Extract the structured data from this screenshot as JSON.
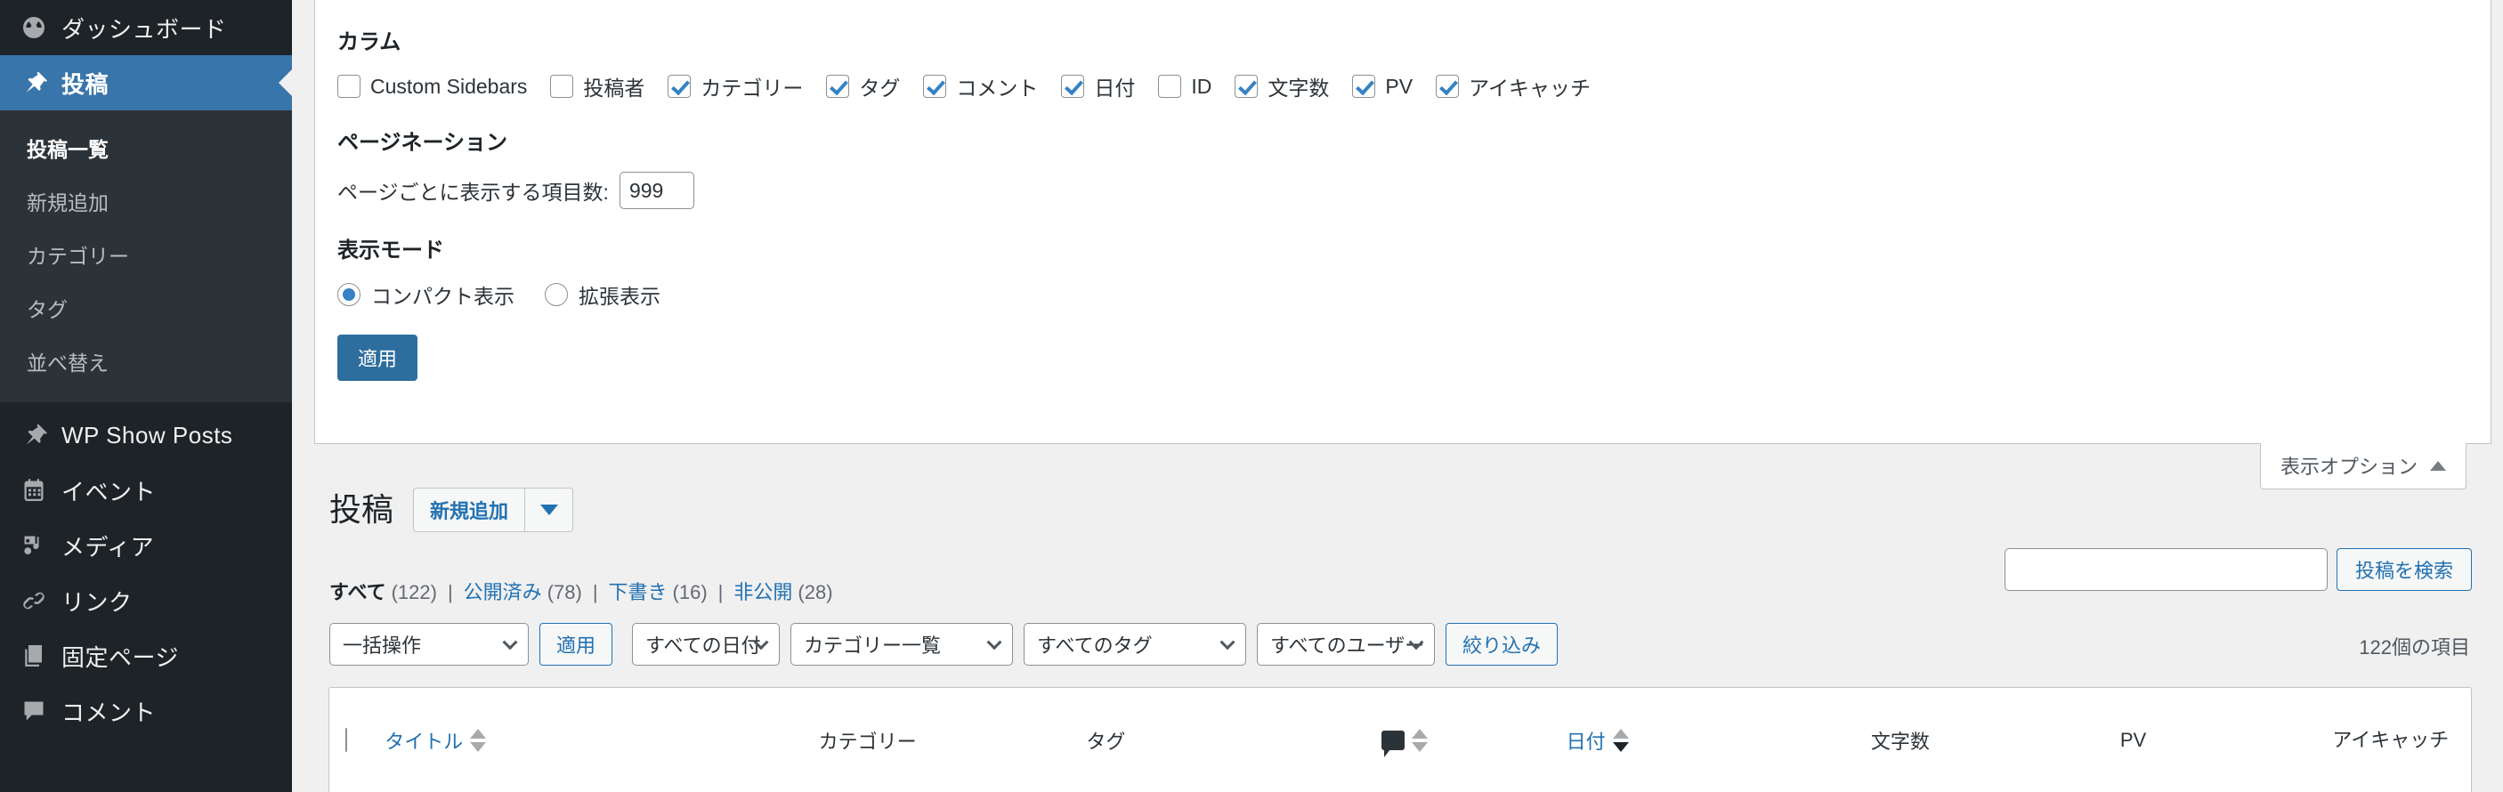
{
  "sidebar": {
    "items": [
      {
        "label": "ダッシュボード",
        "icon": "dashboard-icon",
        "current": false
      },
      {
        "label": "投稿",
        "icon": "pin-icon",
        "current": true
      }
    ],
    "submenu": [
      {
        "label": "投稿一覧",
        "current": true
      },
      {
        "label": "新規追加",
        "current": false
      },
      {
        "label": "カテゴリー",
        "current": false
      },
      {
        "label": "タグ",
        "current": false
      },
      {
        "label": "並べ替え",
        "current": false
      }
    ],
    "items2": [
      {
        "label": "WP Show Posts",
        "icon": "pin-icon"
      },
      {
        "label": "イベント",
        "icon": "calendar-icon"
      },
      {
        "label": "メディア",
        "icon": "media-icon"
      },
      {
        "label": "リンク",
        "icon": "link-icon"
      },
      {
        "label": "固定ページ",
        "icon": "pages-icon"
      },
      {
        "label": "コメント",
        "icon": "comment-icon"
      }
    ]
  },
  "screen_options": {
    "columns_legend": "カラム",
    "columns": [
      {
        "label": "Custom Sidebars",
        "checked": false
      },
      {
        "label": "投稿者",
        "checked": false
      },
      {
        "label": "カテゴリー",
        "checked": true
      },
      {
        "label": "タグ",
        "checked": true
      },
      {
        "label": "コメント",
        "checked": true
      },
      {
        "label": "日付",
        "checked": true
      },
      {
        "label": "ID",
        "checked": false
      },
      {
        "label": "文字数",
        "checked": true
      },
      {
        "label": "PV",
        "checked": true
      },
      {
        "label": "アイキャッチ",
        "checked": true
      }
    ],
    "pagination_legend": "ページネーション",
    "per_page_label": "ページごとに表示する項目数:",
    "per_page_value": "999",
    "view_mode_legend": "表示モード",
    "view_modes": [
      {
        "label": "コンパクト表示",
        "checked": true
      },
      {
        "label": "拡張表示",
        "checked": false
      }
    ],
    "apply_label": "適用",
    "toggle_label": "表示オプション"
  },
  "page": {
    "title": "投稿",
    "add_new_label": "新規追加",
    "items_count": "122個の項目"
  },
  "status_links": [
    {
      "label": "すべて",
      "count": "(122)",
      "current": true
    },
    {
      "label": "公開済み",
      "count": "(78)",
      "current": false
    },
    {
      "label": "下書き",
      "count": "(16)",
      "current": false
    },
    {
      "label": "非公開",
      "count": "(28)",
      "current": false
    }
  ],
  "tablenav": {
    "bulk_action": "一括操作",
    "apply_label": "適用",
    "date_filter": "すべての日付",
    "category_filter": "カテゴリー一覧",
    "tag_filter": "すべてのタグ",
    "user_filter": "すべてのユーザー",
    "filter_label": "絞り込み"
  },
  "search": {
    "value": "",
    "placeholder": "",
    "button_label": "投稿を検索"
  },
  "table": {
    "headers": {
      "title": "タイトル",
      "category": "カテゴリー",
      "tag": "タグ",
      "comments": "コメント",
      "date": "日付",
      "words": "文字数",
      "pv": "PV",
      "thumb": "アイキャッチ"
    }
  },
  "colors": {
    "sidebar_bg": "#1d2327",
    "submenu_bg": "#2c3338",
    "accent": "#3875aa",
    "link": "#2271b1",
    "button_primary": "#2e6e9e",
    "page_bg": "#f0f0f1"
  }
}
